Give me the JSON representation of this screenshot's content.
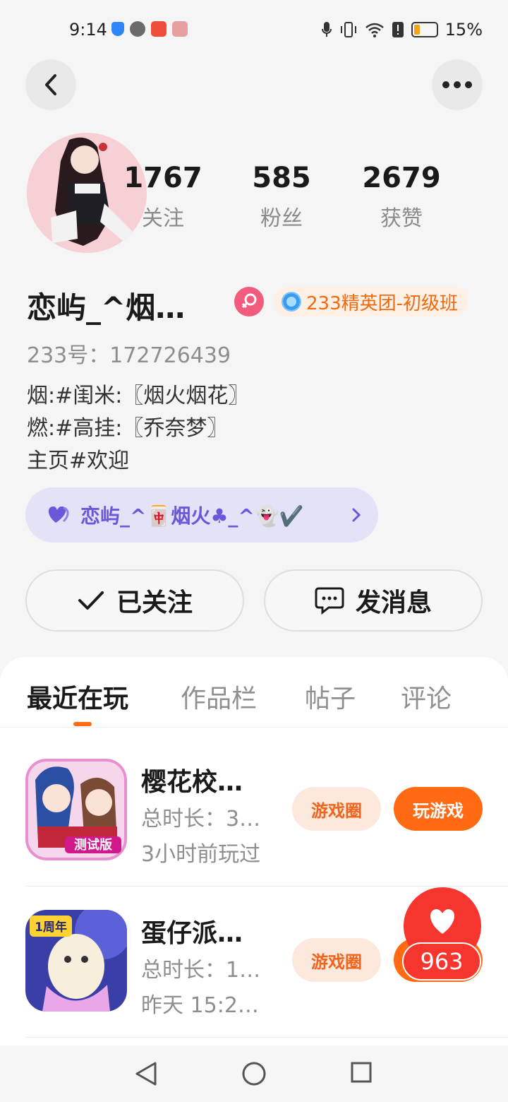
{
  "status_bar": {
    "time": "9:14",
    "battery_pct": "15%",
    "battery_level": 0.15,
    "icons_left": [
      "shield-icon",
      "wechat-icon",
      "app-icon",
      "box-icon"
    ],
    "icons_right": [
      "mic-icon",
      "vibrate-icon",
      "wifi-icon",
      "alert-icon",
      "battery-icon"
    ]
  },
  "header": {
    "back_icon": "chevron-left-icon",
    "more_icon": "more-dots-icon"
  },
  "profile": {
    "stats": [
      {
        "value": "1767",
        "label": "关注"
      },
      {
        "value": "585",
        "label": "粉丝"
      },
      {
        "value": "2679",
        "label": "获赞"
      }
    ],
    "username": "恋屿_^烟…",
    "gender_icon": "female-icon",
    "badge": "233精英团-初级班",
    "uid": "233号：172726439",
    "bio": [
      "烟:#闺米:〖烟火烟花〗",
      "燃:#高挂:〖乔奈梦〗",
      "主页#欢迎"
    ],
    "club": "恋屿_^🀄烟火♣_^👻✔️",
    "follow_label": "已关注",
    "message_label": "发消息"
  },
  "tabs": [
    {
      "label": "最近在玩",
      "active": true
    },
    {
      "label": "作品栏",
      "active": false
    },
    {
      "label": "帖子",
      "active": false
    },
    {
      "label": "评论",
      "active": false
    }
  ],
  "games": [
    {
      "title": "樱花校…",
      "playtime": "总时长：3…",
      "last_played": "3小时前玩过",
      "icon_text": "测试版",
      "circle_label": "游戏圈",
      "play_label": "玩游戏"
    },
    {
      "title": "蛋仔派…",
      "playtime": "总时长：1…",
      "last_played": "昨天 15:2…",
      "icon_text": "1周年",
      "circle_label": "游戏圈"
    }
  ],
  "likes": {
    "count": "963"
  },
  "colors": {
    "accent": "#ff6a12",
    "like_red": "#f5352e",
    "club_purple": "#6a57d9"
  }
}
